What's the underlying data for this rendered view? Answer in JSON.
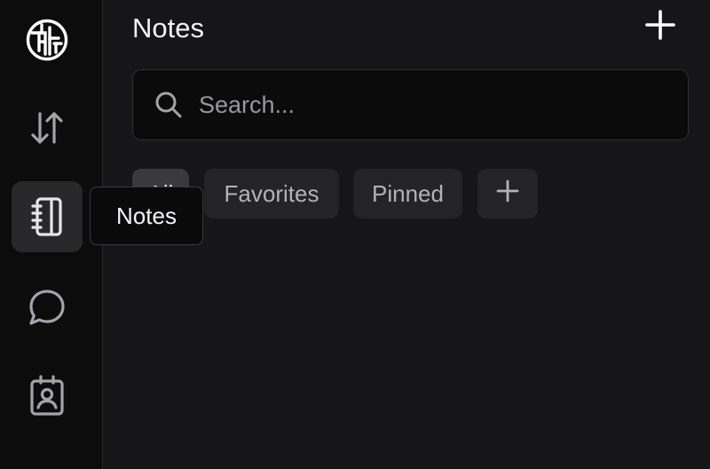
{
  "app": {
    "logo_icon": "circuit-logo-icon"
  },
  "sidebar": {
    "items": [
      {
        "id": "transfer",
        "icon": "arrows-up-down-icon"
      },
      {
        "id": "notes",
        "icon": "notebook-icon",
        "active": true,
        "tooltip": "Notes"
      },
      {
        "id": "chat",
        "icon": "chat-bubble-icon"
      },
      {
        "id": "contacts",
        "icon": "contact-card-icon"
      }
    ]
  },
  "header": {
    "title": "Notes",
    "add_icon": "plus-icon"
  },
  "search": {
    "placeholder": "Search...",
    "value": ""
  },
  "filters": {
    "chips": [
      {
        "label": "All",
        "active": true
      },
      {
        "label": "Favorites"
      },
      {
        "label": "Pinned"
      }
    ],
    "add_icon": "plus-icon"
  },
  "colors": {
    "background": "#161618",
    "rail": "#0c0c0d",
    "chip": "#242427",
    "text": "#f2f2f4",
    "muted": "#97979e"
  }
}
